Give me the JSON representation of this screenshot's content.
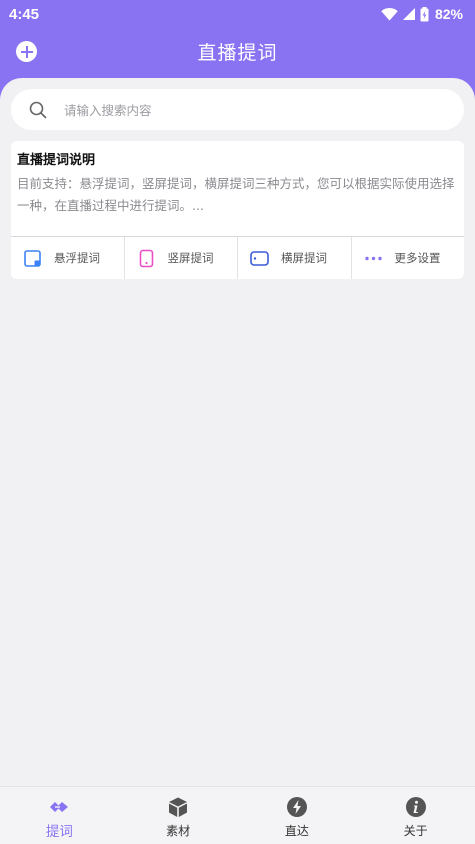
{
  "status_bar": {
    "time": "4:45",
    "battery": "82%"
  },
  "header": {
    "title": "直播提词"
  },
  "search": {
    "placeholder": "请输入搜索内容"
  },
  "card": {
    "title": "直播提词说明",
    "description": "目前支持：悬浮提词，竖屏提词，横屏提词三种方式，您可以根据实际使用选择一种，在直播过程中进行提词。..."
  },
  "actions": [
    {
      "label": "悬浮提词",
      "icon": "floating-window-icon",
      "color": "#3b82f6"
    },
    {
      "label": "竖屏提词",
      "icon": "portrait-phone-icon",
      "color": "#ec4fc4"
    },
    {
      "label": "横屏提词",
      "icon": "landscape-phone-icon",
      "color": "#3b5bd6"
    },
    {
      "label": "更多设置",
      "icon": "more-dots-icon",
      "color": "#8a73f2"
    }
  ],
  "nav": [
    {
      "label": "提词",
      "icon": "prompter-icon",
      "active": true
    },
    {
      "label": "素材",
      "icon": "box-icon",
      "active": false
    },
    {
      "label": "直达",
      "icon": "lightning-icon",
      "active": false
    },
    {
      "label": "关于",
      "icon": "info-icon",
      "active": false
    }
  ],
  "colors": {
    "accent": "#8a73f2",
    "background": "#f1f1f4"
  }
}
